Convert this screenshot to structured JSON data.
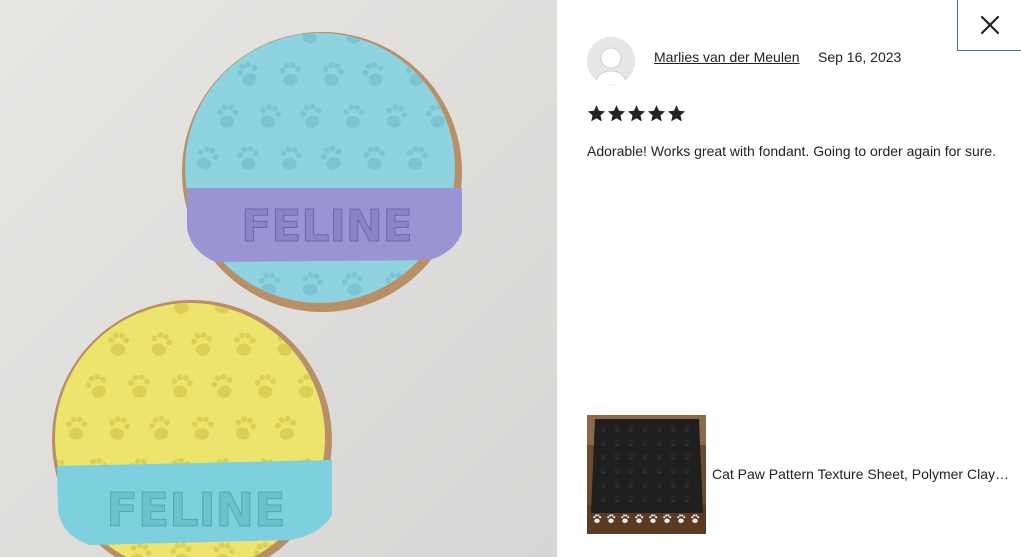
{
  "photo": {
    "cookie_top_label": "FELINE",
    "cookie_bottom_label": "FELINE"
  },
  "review": {
    "reviewer_name": "Marlies van der Meulen",
    "date": "Sep 16, 2023",
    "rating": 5,
    "max_rating": 5,
    "text": "Adorable! Works great with fondant. Going to order again for sure."
  },
  "product": {
    "title": "Cat Paw Pattern Texture Sheet, Polymer Clay Texture Mat"
  },
  "icons": {
    "close": "close-icon",
    "star": "star-icon",
    "avatar": "user-avatar-icon"
  },
  "colors": {
    "star": "#222222",
    "close_border": "#4a6fb0",
    "cookie_top": "#8fd2e0",
    "cookie_bottom": "#ece46c",
    "band_top": "#9b94d3",
    "band_bottom": "#7fd0df"
  }
}
